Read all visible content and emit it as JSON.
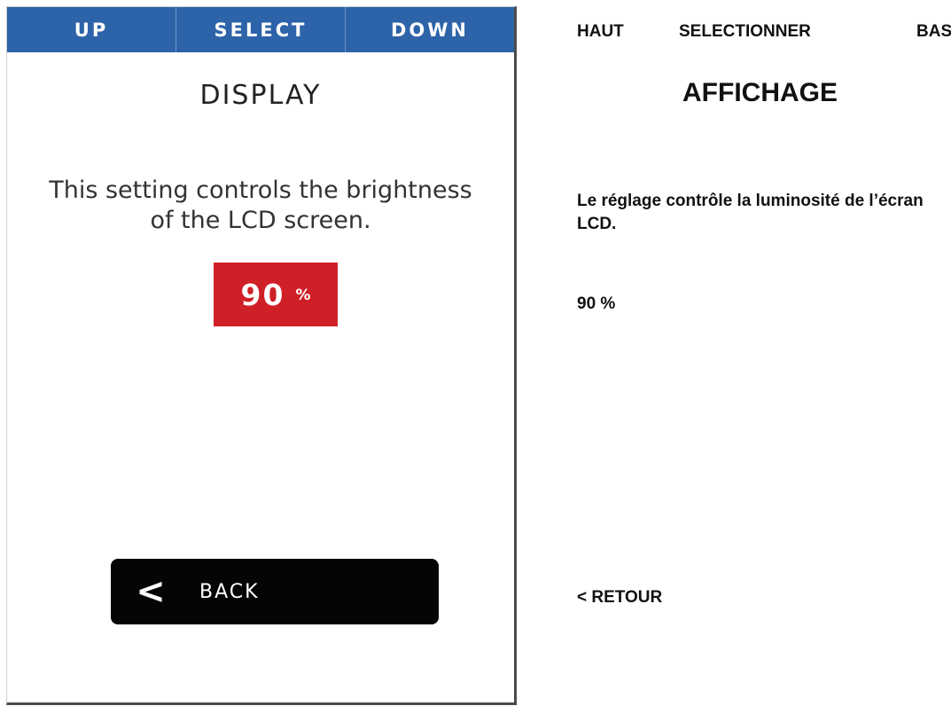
{
  "device": {
    "nav": {
      "up_label": "UP",
      "select_label": "SELECT",
      "down_label": "DOWN"
    },
    "title": "DISPLAY",
    "description": "This setting controls the brightness of the LCD screen.",
    "value": {
      "number": "90",
      "unit": "%"
    },
    "back": {
      "chevron": "<",
      "label": "BACK"
    }
  },
  "translation": {
    "up_label": "HAUT",
    "select_label": "SELECTIONNER",
    "down_label": "BAS",
    "title": "AFFICHAGE",
    "description": "Le réglage contrôle la luminosité de l’écran LCD.",
    "value": "90 %",
    "back_label": "< RETOUR"
  },
  "colors": {
    "nav_bar": "#2d63a8",
    "value_box": "#cf2027",
    "back_button": "#050505"
  }
}
